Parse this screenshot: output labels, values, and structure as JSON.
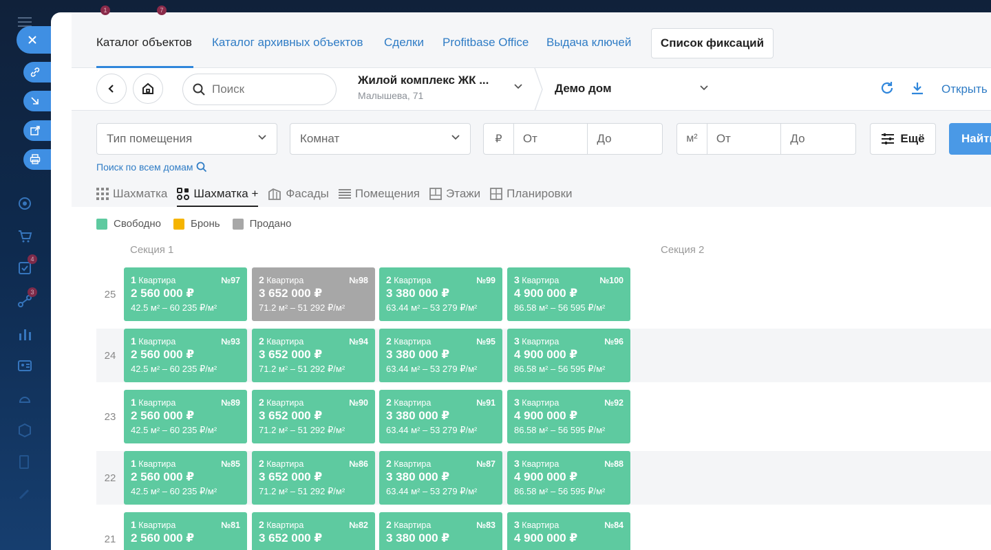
{
  "sidebar": {
    "badges": [
      "1",
      "7",
      "4",
      "3"
    ]
  },
  "tabs": {
    "items": [
      {
        "label": "Каталог объектов"
      },
      {
        "label": "Каталог архивных объектов"
      },
      {
        "label": "Сделки"
      },
      {
        "label": "Profitbase Office"
      },
      {
        "label": "Выдача ключей"
      }
    ],
    "fix_button": "Список фиксаций"
  },
  "toolbar": {
    "search_placeholder": "Поиск",
    "complex_name": "Жилой комплекс ЖК ...",
    "complex_address": "Малышева, 71",
    "house_name": "Демо дом",
    "open_label": "Открыть"
  },
  "filters": {
    "room_type": "Тип помещения",
    "rooms": "Комнат",
    "price_unit": "₽",
    "area_unit": "м²",
    "from": "От",
    "to": "До",
    "more": "Ещё",
    "find": "Найти",
    "search_all": "Поиск по всем домам"
  },
  "views": [
    {
      "label": "Шахматка"
    },
    {
      "label": "Шахматка +"
    },
    {
      "label": "Фасады"
    },
    {
      "label": "Помещения"
    },
    {
      "label": "Этажи"
    },
    {
      "label": "Планировки"
    }
  ],
  "legend": [
    {
      "label": "Свободно",
      "color": "#5ecaa0"
    },
    {
      "label": "Бронь",
      "color": "#f5b400"
    },
    {
      "label": "Продано",
      "color": "#a7a7a7"
    }
  ],
  "sections": [
    "Секция 1",
    "Секция 2"
  ],
  "floors": [
    {
      "floor": "25",
      "units": [
        {
          "rooms": "1",
          "type": "Квартира",
          "num": "№97",
          "price": "2 560 000 ₽",
          "area": "42.5 м² – 60 235 ₽/м²",
          "status": "free"
        },
        {
          "rooms": "2",
          "type": "Квартира",
          "num": "№98",
          "price": "3 652 000 ₽",
          "area": "71.2 м² – 51 292 ₽/м²",
          "status": "sold"
        },
        {
          "rooms": "2",
          "type": "Квартира",
          "num": "№99",
          "price": "3 380 000 ₽",
          "area": "63.44 м² – 53 279 ₽/м²",
          "status": "free"
        },
        {
          "rooms": "3",
          "type": "Квартира",
          "num": "№100",
          "price": "4 900 000 ₽",
          "area": "86.58 м² – 56 595 ₽/м²",
          "status": "free"
        }
      ]
    },
    {
      "floor": "24",
      "units": [
        {
          "rooms": "1",
          "type": "Квартира",
          "num": "№93",
          "price": "2 560 000 ₽",
          "area": "42.5 м² – 60 235 ₽/м²",
          "status": "free"
        },
        {
          "rooms": "2",
          "type": "Квартира",
          "num": "№94",
          "price": "3 652 000 ₽",
          "area": "71.2 м² – 51 292 ₽/м²",
          "status": "free"
        },
        {
          "rooms": "2",
          "type": "Квартира",
          "num": "№95",
          "price": "3 380 000 ₽",
          "area": "63.44 м² – 53 279 ₽/м²",
          "status": "free"
        },
        {
          "rooms": "3",
          "type": "Квартира",
          "num": "№96",
          "price": "4 900 000 ₽",
          "area": "86.58 м² – 56 595 ₽/м²",
          "status": "free"
        }
      ]
    },
    {
      "floor": "23",
      "units": [
        {
          "rooms": "1",
          "type": "Квартира",
          "num": "№89",
          "price": "2 560 000 ₽",
          "area": "42.5 м² – 60 235 ₽/м²",
          "status": "free"
        },
        {
          "rooms": "2",
          "type": "Квартира",
          "num": "№90",
          "price": "3 652 000 ₽",
          "area": "71.2 м² – 51 292 ₽/м²",
          "status": "free"
        },
        {
          "rooms": "2",
          "type": "Квартира",
          "num": "№91",
          "price": "3 380 000 ₽",
          "area": "63.44 м² – 53 279 ₽/м²",
          "status": "free"
        },
        {
          "rooms": "3",
          "type": "Квартира",
          "num": "№92",
          "price": "4 900 000 ₽",
          "area": "86.58 м² – 56 595 ₽/м²",
          "status": "free"
        }
      ]
    },
    {
      "floor": "22",
      "units": [
        {
          "rooms": "1",
          "type": "Квартира",
          "num": "№85",
          "price": "2 560 000 ₽",
          "area": "42.5 м² – 60 235 ₽/м²",
          "status": "free"
        },
        {
          "rooms": "2",
          "type": "Квартира",
          "num": "№86",
          "price": "3 652 000 ₽",
          "area": "71.2 м² – 51 292 ₽/м²",
          "status": "free"
        },
        {
          "rooms": "2",
          "type": "Квартира",
          "num": "№87",
          "price": "3 380 000 ₽",
          "area": "63.44 м² – 53 279 ₽/м²",
          "status": "free"
        },
        {
          "rooms": "3",
          "type": "Квартира",
          "num": "№88",
          "price": "4 900 000 ₽",
          "area": "86.58 м² – 56 595 ₽/м²",
          "status": "free"
        }
      ]
    },
    {
      "floor": "21",
      "units": [
        {
          "rooms": "1",
          "type": "Квартира",
          "num": "№81",
          "price": "2 560 000 ₽",
          "area": "",
          "status": "free"
        },
        {
          "rooms": "2",
          "type": "Квартира",
          "num": "№82",
          "price": "3 652 000 ₽",
          "area": "",
          "status": "free"
        },
        {
          "rooms": "2",
          "type": "Квартира",
          "num": "№83",
          "price": "3 380 000 ₽",
          "area": "",
          "status": "free"
        },
        {
          "rooms": "3",
          "type": "Квартира",
          "num": "№84",
          "price": "4 900 000 ₽",
          "area": "",
          "status": "free"
        }
      ]
    }
  ]
}
